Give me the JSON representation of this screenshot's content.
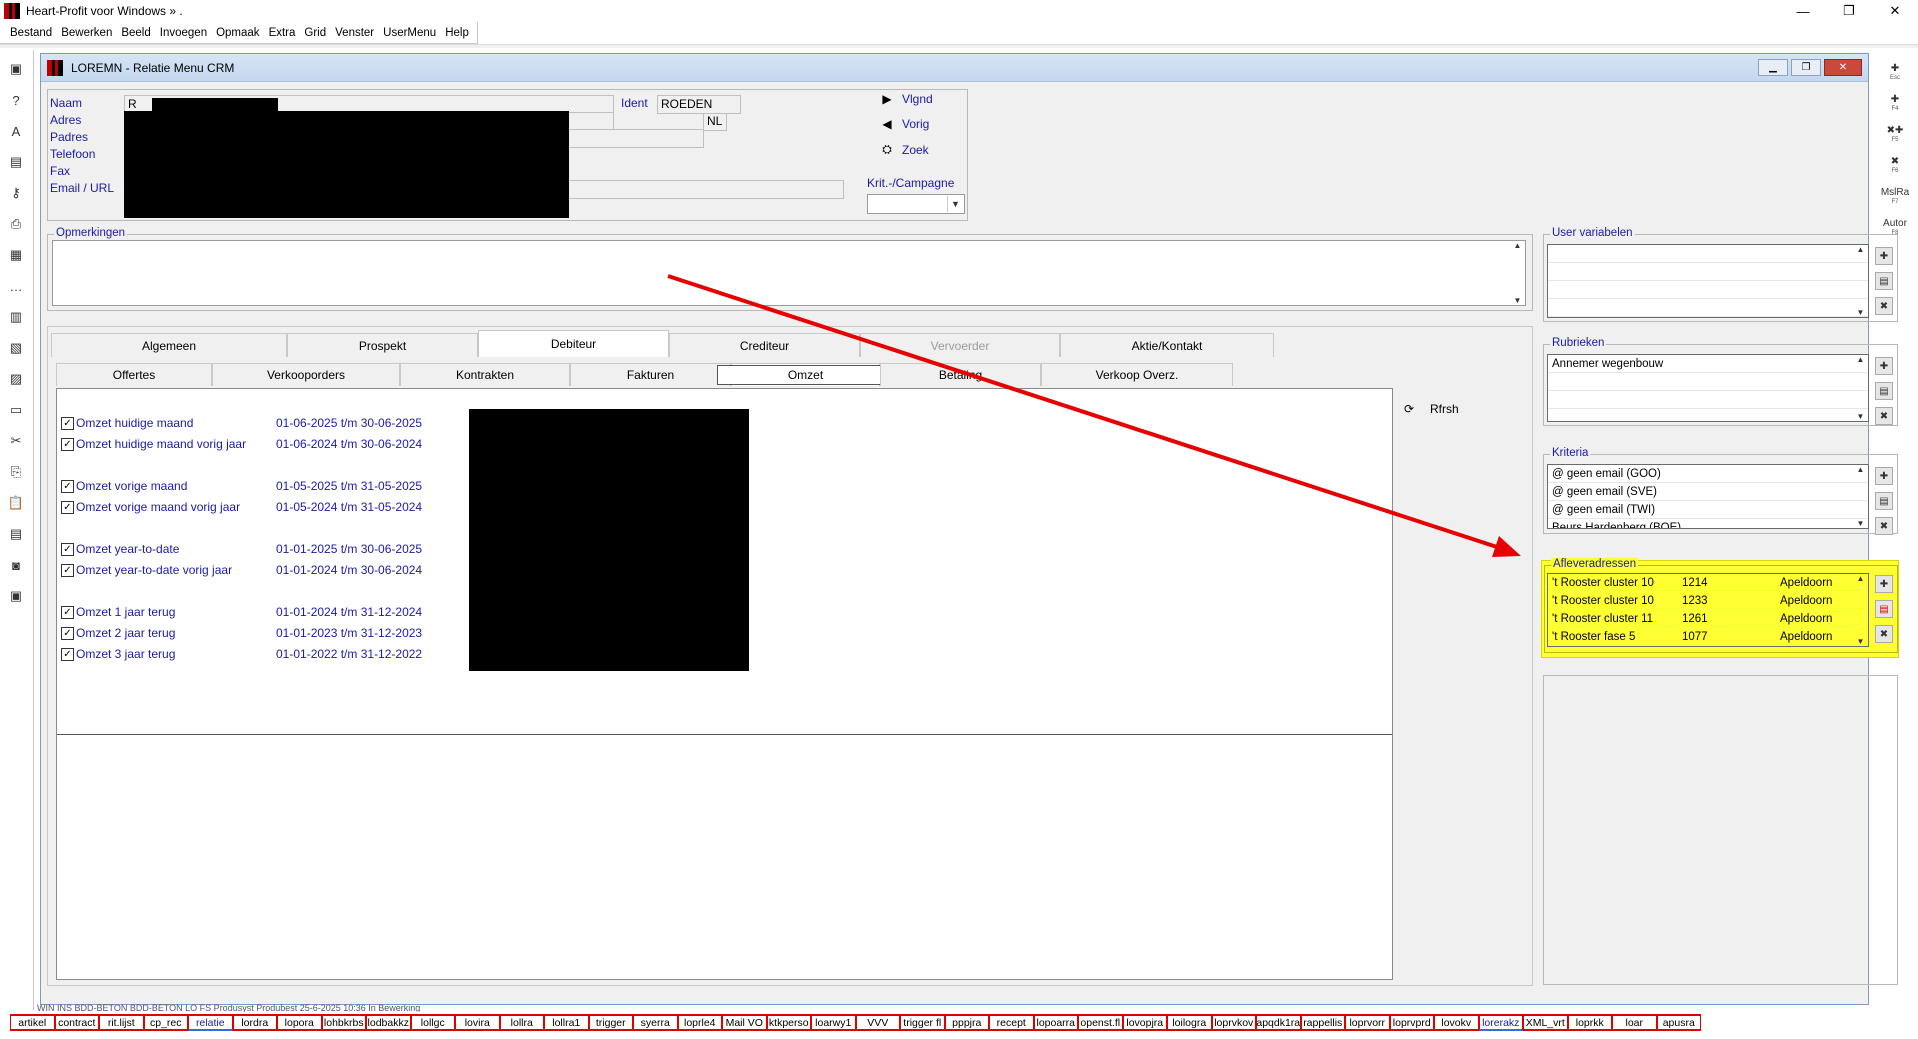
{
  "app": {
    "title": "Heart-Profit voor Windows  »  .",
    "min": "—",
    "max": "❐",
    "close": "✕"
  },
  "menu": [
    "Bestand",
    "Bewerken",
    "Beeld",
    "Invoegen",
    "Opmaak",
    "Extra",
    "Grid",
    "Venster",
    "UserMenu",
    "Help"
  ],
  "left_toolbar": [
    {
      "name": "screen-icon",
      "glyph": "▣"
    },
    {
      "name": "help-icon",
      "glyph": "?"
    },
    {
      "name": "font-icon",
      "glyph": "A"
    },
    {
      "name": "card-icon",
      "glyph": "▤"
    },
    {
      "name": "key-icon",
      "glyph": "⚷"
    },
    {
      "name": "print-icon",
      "glyph": "⎙"
    },
    {
      "name": "window-icon",
      "glyph": "▦"
    },
    {
      "name": "dots-icon",
      "glyph": "…"
    },
    {
      "name": "grid-icon",
      "glyph": "▥"
    },
    {
      "name": "form-icon",
      "glyph": "▧"
    },
    {
      "name": "chart-icon",
      "glyph": "▨"
    },
    {
      "name": "list-icon",
      "glyph": "▭"
    },
    {
      "name": "scissors-icon",
      "glyph": "✂"
    },
    {
      "name": "copy-icon",
      "glyph": "⎘"
    },
    {
      "name": "paste-icon",
      "glyph": "📋"
    },
    {
      "name": "doc-icon",
      "glyph": "▤"
    },
    {
      "name": "camera-icon",
      "glyph": "◙"
    },
    {
      "name": "monitor-icon",
      "glyph": "▣"
    }
  ],
  "right_toolbar": [
    {
      "name": "esc-button",
      "label": "✚",
      "key": "Esc"
    },
    {
      "name": "f4-button",
      "label": "✚",
      "key": "F4"
    },
    {
      "name": "f5-button",
      "label": "✖✚",
      "key": "F5"
    },
    {
      "name": "f6-button",
      "label": "✖",
      "key": "F6"
    },
    {
      "name": "f7-button",
      "label": "MslRa",
      "key": "F7"
    },
    {
      "name": "f8-button",
      "label": "Autor",
      "key": "F8"
    }
  ],
  "window": {
    "title": "LOREMN - Relatie Menu CRM",
    "min": "▁",
    "max": "❐",
    "close": "✕"
  },
  "contact": {
    "labels": {
      "naam": "Naam",
      "adres": "Adres",
      "padres": "Padres",
      "telefoon": "Telefoon",
      "fax": "Fax",
      "email": "Email / URL",
      "ident": "Ident"
    },
    "naam_value": "R",
    "ident_value": "ROEDEN",
    "country": "NL"
  },
  "nav": {
    "next": "Vlgnd",
    "prev": "Vorig",
    "search": "Zoek",
    "next_icon": "▶",
    "prev_icon": "◀",
    "search_icon": "⛭",
    "campaign_label": "Krit.-/Campagne",
    "campaign_value": ""
  },
  "opmerkingen": {
    "legend": "Opmerkingen",
    "value": ""
  },
  "main_tabs": [
    {
      "label": "Algemeen",
      "state": "normal"
    },
    {
      "label": "Prospekt",
      "state": "normal"
    },
    {
      "label": "Debiteur",
      "state": "active"
    },
    {
      "label": "Crediteur",
      "state": "normal"
    },
    {
      "label": "Vervoerder",
      "state": "disabled"
    },
    {
      "label": "Aktie/Kontakt",
      "state": "normal"
    }
  ],
  "sub_tabs": [
    {
      "label": "Offertes",
      "state": "normal"
    },
    {
      "label": "Verkooporders",
      "state": "normal"
    },
    {
      "label": "Kontrakten",
      "state": "normal"
    },
    {
      "label": "Fakturen",
      "state": "normal"
    },
    {
      "label": "Omzet",
      "state": "active"
    },
    {
      "label": "Betaling",
      "state": "normal"
    },
    {
      "label": "Verkoop Overz.",
      "state": "normal"
    }
  ],
  "omzet_rows": [
    {
      "label": "Omzet huidige maand",
      "period": "01-06-2025 t/m 30-06-2025",
      "checked": true
    },
    {
      "label": "Omzet huidige maand vorig jaar",
      "period": "01-06-2024 t/m 30-06-2024",
      "checked": true
    },
    {
      "label": "Omzet vorige maand",
      "period": "01-05-2025 t/m 31-05-2025",
      "checked": true
    },
    {
      "label": "Omzet vorige maand vorig jaar",
      "period": "01-05-2024 t/m 31-05-2024",
      "checked": true
    },
    {
      "label": "Omzet year-to-date",
      "period": "01-01-2025 t/m 30-06-2025",
      "checked": true
    },
    {
      "label": "Omzet year-to-date vorig jaar",
      "period": "01-01-2024 t/m 30-06-2024",
      "checked": true
    },
    {
      "label": "Omzet 1 jaar terug",
      "period": "01-01-2024 t/m 31-12-2024",
      "checked": true
    },
    {
      "label": "Omzet 2 jaar terug",
      "period": "01-01-2023 t/m 31-12-2023",
      "checked": true
    },
    {
      "label": "Omzet 3 jaar terug",
      "period": "01-01-2022 t/m 31-12-2022",
      "checked": true
    }
  ],
  "refresh": {
    "label": "Rfrsh",
    "icon": "⟳"
  },
  "user_variabelen": {
    "legend": "User variabelen",
    "rows": [
      "",
      "",
      "",
      ""
    ]
  },
  "rubrieken": {
    "legend": "Rubrieken",
    "rows": [
      "Annemer wegenbouw",
      "",
      ""
    ]
  },
  "kriteria": {
    "legend": "Kriteria",
    "rows": [
      "@ geen email (GOO)",
      "@ geen email (SVE)",
      "@ geen email (TWI)",
      "Beurs Hardenberg (BOE)"
    ]
  },
  "afleveradressen": {
    "legend": "Afleveradressen",
    "rows": [
      {
        "name": "'t Rooster cluster 10",
        "nr": "1214",
        "city": "Apeldoorn"
      },
      {
        "name": "'t Rooster cluster 10",
        "nr": "1233",
        "city": "Apeldoorn"
      },
      {
        "name": "'t Rooster cluster 11",
        "nr": "1261",
        "city": "Apeldoorn"
      },
      {
        "name": "'t Rooster fase 5",
        "nr": "1077",
        "city": "Apeldoorn"
      }
    ]
  },
  "side_icons": {
    "add": "✚",
    "edit": "▤",
    "delete": "✖"
  },
  "statusbar": "WIN     INS    BDD-BETON      BDD-BETON        LO   FS       Produsyst     Produbest   25-6-2025      10:36    In Bewerking",
  "bottom_tabs": [
    {
      "label": "artikel"
    },
    {
      "label": "contract"
    },
    {
      "label": "rit.lijst"
    },
    {
      "label": "cp_rec"
    },
    {
      "label": "relatie",
      "active": true
    },
    {
      "label": "lordra"
    },
    {
      "label": "lopora"
    },
    {
      "label": "lohbkrbs"
    },
    {
      "label": "lodbakkz"
    },
    {
      "label": "lollgc"
    },
    {
      "label": "lovira"
    },
    {
      "label": "lollra"
    },
    {
      "label": "lollra1"
    },
    {
      "label": "trigger"
    },
    {
      "label": "syerra"
    },
    {
      "label": "loprle4"
    },
    {
      "label": "Mail VO"
    },
    {
      "label": "ktkperso"
    },
    {
      "label": "loarwy1"
    },
    {
      "label": "VVV"
    },
    {
      "label": "trigger fl"
    },
    {
      "label": "pppjra"
    },
    {
      "label": "recept"
    },
    {
      "label": "lopoarra"
    },
    {
      "label": "openst.fl"
    },
    {
      "label": "lovopjra"
    },
    {
      "label": "loilogra"
    },
    {
      "label": "loprvkov"
    },
    {
      "label": "apqdk1ra"
    },
    {
      "label": "rappellis"
    },
    {
      "label": "loprvorr"
    },
    {
      "label": "loprvprd"
    },
    {
      "label": "lovokv"
    },
    {
      "label": "lorerakz",
      "active": true
    },
    {
      "label": "XML_vrt"
    },
    {
      "label": "loprkk"
    },
    {
      "label": "loar"
    },
    {
      "label": "apusra"
    }
  ],
  "colors": {
    "highlight": "#ffff33",
    "arrow": "#e60000",
    "label_blue": "#1a1aa6"
  }
}
